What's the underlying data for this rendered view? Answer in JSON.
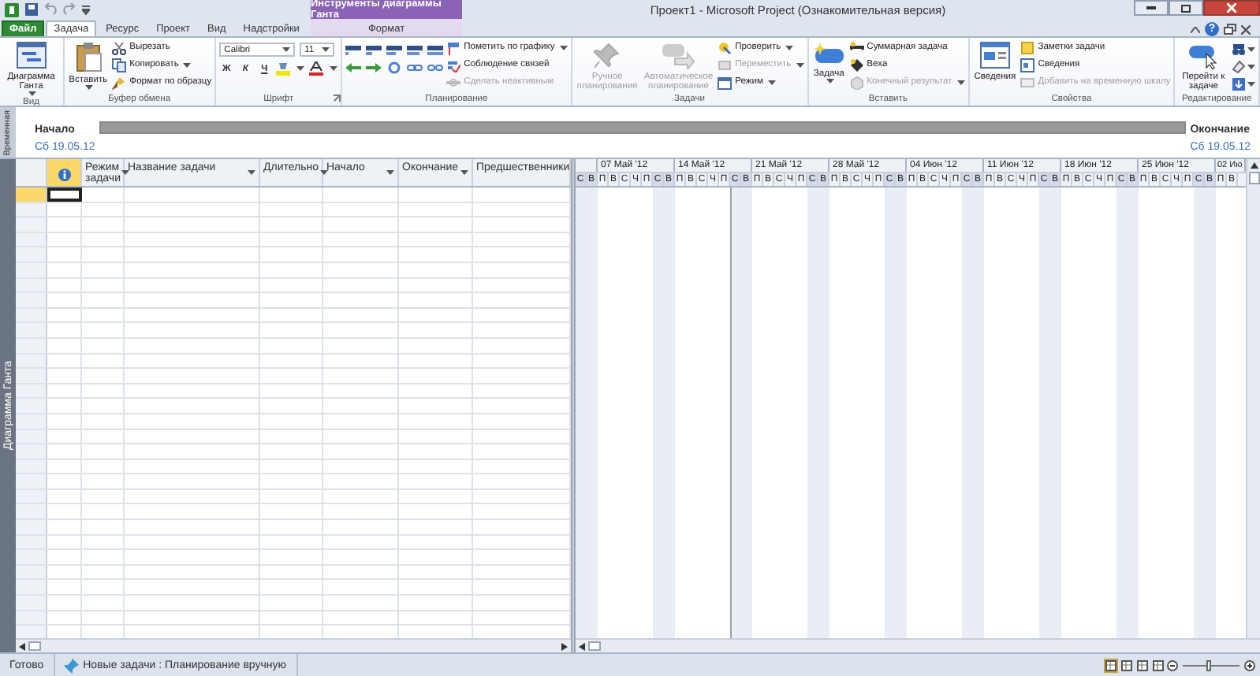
{
  "title_bar": {
    "context_label": "Инструменты диаграммы Ганта",
    "title": "Проект1  -  Microsoft Project (Ознакомительная версия)",
    "help_button": "?"
  },
  "tabs": [
    {
      "label": "Файл",
      "kind": "file",
      "selected": false
    },
    {
      "label": "Задача",
      "kind": "normal",
      "selected": true
    },
    {
      "label": "Ресурс",
      "kind": "normal",
      "selected": false
    },
    {
      "label": "Проект",
      "kind": "normal",
      "selected": false
    },
    {
      "label": "Вид",
      "kind": "normal",
      "selected": false
    },
    {
      "label": "Надстройки",
      "kind": "normal",
      "selected": false
    },
    {
      "label": "Формат",
      "kind": "contextual",
      "selected": false
    }
  ],
  "ribbon": {
    "groups": [
      {
        "label": "Вид",
        "items": [
          {
            "kind": "large",
            "label": "Диаграмма Ганта",
            "dropdown": true,
            "disabled": false
          }
        ]
      },
      {
        "label": "Буфер обмена",
        "items": [
          {
            "kind": "large",
            "label": "Вставить",
            "dropdown": true,
            "disabled": false
          },
          {
            "kind": "stack",
            "rows": [
              {
                "label": "Вырезать",
                "dropdown": false,
                "disabled": false
              },
              {
                "label": "Копировать",
                "dropdown": true,
                "disabled": false
              },
              {
                "label": "Формат по образцу",
                "dropdown": false,
                "disabled": false
              }
            ]
          }
        ]
      },
      {
        "label": "Шрифт",
        "launcher": true,
        "items": [
          {
            "kind": "font",
            "font": "Calibri",
            "size": "11",
            "format_buttons": [
              "Ж",
              "К",
              "Ч"
            ]
          }
        ]
      },
      {
        "label": "Планирование",
        "items": [
          {
            "kind": "icon_grid"
          },
          {
            "kind": "stack",
            "rows": [
              {
                "label": "Пометить по графику",
                "dropdown": true,
                "disabled": false
              },
              {
                "label": "Соблюдение связей",
                "dropdown": false,
                "disabled": false
              },
              {
                "label": "Сделать неактивным",
                "dropdown": false,
                "disabled": true
              }
            ]
          }
        ]
      },
      {
        "label": "Задачи",
        "items": [
          {
            "kind": "large",
            "label": "Ручное планирование",
            "dropdown": false,
            "disabled": true
          },
          {
            "kind": "large",
            "label": "Автоматическое планирование",
            "dropdown": false,
            "disabled": true
          },
          {
            "kind": "stack",
            "rows": [
              {
                "label": "Проверить",
                "dropdown": true,
                "disabled": false
              },
              {
                "label": "Переместить",
                "dropdown": true,
                "disabled": true
              },
              {
                "label": "Режим",
                "dropdown": true,
                "disabled": false
              }
            ]
          }
        ]
      },
      {
        "label": "Вставить",
        "items": [
          {
            "kind": "large",
            "label": "Задача",
            "dropdown": true,
            "disabled": false
          },
          {
            "kind": "stack",
            "rows": [
              {
                "label": "Суммарная задача",
                "dropdown": false,
                "disabled": false
              },
              {
                "label": "Веха",
                "dropdown": false,
                "disabled": false
              },
              {
                "label": "Конечный результат",
                "dropdown": true,
                "disabled": true
              }
            ]
          }
        ]
      },
      {
        "label": "Свойства",
        "items": [
          {
            "kind": "large",
            "label": "Сведения",
            "dropdown": false,
            "disabled": false
          },
          {
            "kind": "stack",
            "rows": [
              {
                "label": "Заметки задачи",
                "dropdown": false,
                "disabled": false
              },
              {
                "label": "Сведения",
                "dropdown": false,
                "disabled": false
              },
              {
                "label": "Добавить на временную шкалу",
                "dropdown": false,
                "disabled": true
              }
            ]
          }
        ]
      },
      {
        "label": "Редактирование",
        "items": [
          {
            "kind": "large",
            "label": "Перейти к задаче",
            "dropdown": false,
            "disabled": false
          },
          {
            "kind": "icon_stack",
            "buttons": [
              {
                "dropdown": true
              },
              {
                "dropdown": true
              },
              {
                "dropdown": true
              }
            ]
          }
        ]
      }
    ]
  },
  "timeline": {
    "tab_label": "Временная",
    "start_label": "Начало",
    "start_date": "Сб 19.05.12",
    "end_label": "Окончание",
    "end_date": "Сб 19.05.12"
  },
  "view_bar": {
    "label": "Диаграмма Ганта"
  },
  "table": {
    "columns": [
      {
        "kind": "indicator",
        "selected": true
      },
      {
        "kind": "text",
        "label": "Режим задачи",
        "selected": false
      },
      {
        "kind": "text",
        "label": "Название задачи",
        "selected": false
      },
      {
        "kind": "text",
        "label": "Длительно",
        "selected": false
      },
      {
        "kind": "text",
        "label": "Начало",
        "selected": false
      },
      {
        "kind": "text",
        "label": "Окончание",
        "selected": false
      },
      {
        "kind": "text",
        "label": "Предшественники",
        "selected": false
      }
    ],
    "rows": [
      {
        "selected": true
      }
    ]
  },
  "gantt": {
    "weeks": [
      {
        "days": [
          {
            "letter": "С",
            "nonworking": true
          },
          {
            "letter": "В",
            "nonworking": true
          }
        ]
      },
      {
        "label": "07 Май '12",
        "days": [
          {
            "letter": "П",
            "nonworking": false
          },
          {
            "letter": "В",
            "nonworking": false
          },
          {
            "letter": "С",
            "nonworking": false
          },
          {
            "letter": "Ч",
            "nonworking": false
          },
          {
            "letter": "П",
            "nonworking": false
          },
          {
            "letter": "С",
            "nonworking": true
          },
          {
            "letter": "В",
            "nonworking": true
          }
        ]
      },
      {
        "label": "14 Май '12",
        "days": [
          {
            "letter": "П",
            "nonworking": false
          },
          {
            "letter": "В",
            "nonworking": false
          },
          {
            "letter": "С",
            "nonworking": false
          },
          {
            "letter": "Ч",
            "nonworking": false
          },
          {
            "letter": "П",
            "nonworking": false
          },
          {
            "letter": "С",
            "nonworking": true,
            "project_start": true
          },
          {
            "letter": "В",
            "nonworking": true
          }
        ]
      },
      {
        "label": "21 Май '12",
        "days": [
          {
            "letter": "П",
            "nonworking": false
          },
          {
            "letter": "В",
            "nonworking": false
          },
          {
            "letter": "С",
            "nonworking": false
          },
          {
            "letter": "Ч",
            "nonworking": false
          },
          {
            "letter": "П",
            "nonworking": false
          },
          {
            "letter": "С",
            "nonworking": true
          },
          {
            "letter": "В",
            "nonworking": true
          }
        ]
      },
      {
        "label": "28 Май '12",
        "days": [
          {
            "letter": "П",
            "nonworking": false
          },
          {
            "letter": "В",
            "nonworking": false
          },
          {
            "letter": "С",
            "nonworking": false
          },
          {
            "letter": "Ч",
            "nonworking": false
          },
          {
            "letter": "П",
            "nonworking": false
          },
          {
            "letter": "С",
            "nonworking": true
          },
          {
            "letter": "В",
            "nonworking": true
          }
        ]
      },
      {
        "label": "04 Июн '12",
        "days": [
          {
            "letter": "П",
            "nonworking": false
          },
          {
            "letter": "В",
            "nonworking": false
          },
          {
            "letter": "С",
            "nonworking": false
          },
          {
            "letter": "Ч",
            "nonworking": false
          },
          {
            "letter": "П",
            "nonworking": false
          },
          {
            "letter": "С",
            "nonworking": true
          },
          {
            "letter": "В",
            "nonworking": true
          }
        ]
      },
      {
        "label": "11 Июн '12",
        "days": [
          {
            "letter": "П",
            "nonworking": false
          },
          {
            "letter": "В",
            "nonworking": false
          },
          {
            "letter": "С",
            "nonworking": false
          },
          {
            "letter": "Ч",
            "nonworking": false
          },
          {
            "letter": "П",
            "nonworking": false
          },
          {
            "letter": "С",
            "nonworking": true
          },
          {
            "letter": "В",
            "nonworking": true
          }
        ]
      },
      {
        "label": "18 Июн '12",
        "days": [
          {
            "letter": "П",
            "nonworking": false
          },
          {
            "letter": "В",
            "nonworking": false
          },
          {
            "letter": "С",
            "nonworking": false
          },
          {
            "letter": "Ч",
            "nonworking": false
          },
          {
            "letter": "П",
            "nonworking": false
          },
          {
            "letter": "С",
            "nonworking": true
          },
          {
            "letter": "В",
            "nonworking": true
          }
        ]
      },
      {
        "label": "25 Июн '12",
        "days": [
          {
            "letter": "П",
            "nonworking": false
          },
          {
            "letter": "В",
            "nonworking": false
          },
          {
            "letter": "С",
            "nonworking": false
          },
          {
            "letter": "Ч",
            "nonworking": false
          },
          {
            "letter": "П",
            "nonworking": false
          },
          {
            "letter": "С",
            "nonworking": true
          },
          {
            "letter": "В",
            "nonworking": true
          }
        ]
      },
      {
        "label": "02 Ию",
        "days": [
          {
            "letter": "П",
            "nonworking": false
          },
          {
            "letter": "В",
            "nonworking": false
          }
        ]
      }
    ]
  },
  "status_bar": {
    "ready": "Готово",
    "mode": "Новые задачи : Планирование вручную",
    "view_buttons": [
      {
        "selected": true
      },
      {
        "selected": false
      },
      {
        "selected": false
      },
      {
        "selected": false
      }
    ],
    "zoom": {
      "level": 0.45
    }
  }
}
